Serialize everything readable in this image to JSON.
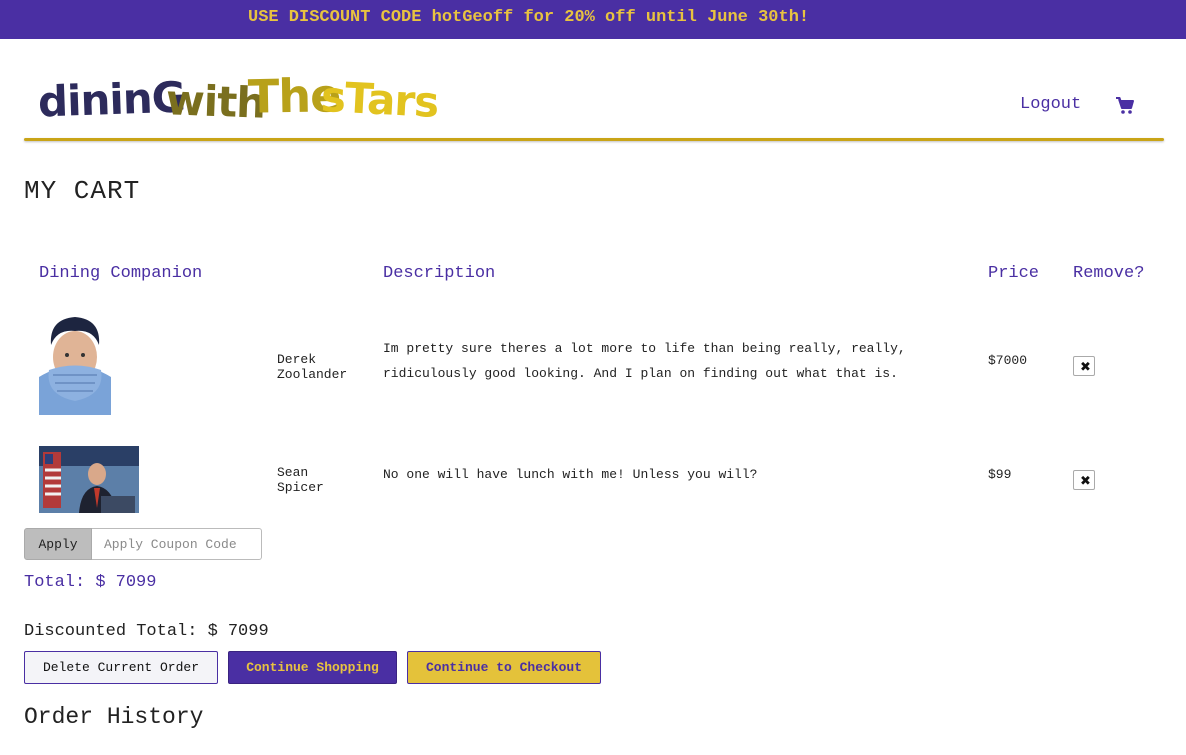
{
  "banner": {
    "text": "USE DISCOUNT CODE hotGeoff for 20% off until June 30th!"
  },
  "header": {
    "logo_words": [
      "dininG",
      "with",
      "The",
      "sTars"
    ],
    "logout_label": "Logout",
    "cart_icon": "shopping-cart-icon"
  },
  "page_title": "MY CART",
  "table": {
    "headers": {
      "companion": "Dining Companion",
      "description": "Description",
      "price": "Price",
      "remove": "Remove?"
    },
    "rows": [
      {
        "name_line1": "Derek",
        "name_line2": "Zoolander",
        "description": "Im pretty sure theres a lot more to life than being really, really, ridiculously good looking. And I plan on finding out what that is.",
        "price": "$7000",
        "remove_icon": "close-icon",
        "remove_label": "✖"
      },
      {
        "name_line1": "Sean",
        "name_line2": "Spicer",
        "description": "No one will have lunch with me! Unless you will?",
        "price": "$99",
        "remove_icon": "close-icon",
        "remove_label": "✖"
      }
    ]
  },
  "coupon": {
    "apply_label": "Apply",
    "placeholder": "Apply Coupon Code",
    "value": ""
  },
  "totals": {
    "total_label": "Total: $",
    "total_value": "7099",
    "discounted_label": "Discounted Total: $",
    "discounted_value": "7099"
  },
  "actions": {
    "delete_label": "Delete Current Order",
    "continue_label": "Continue Shopping",
    "checkout_label": "Continue to Checkout"
  },
  "order_history_title": "Order History",
  "colors": {
    "brand_purple": "#4a2fa3",
    "brand_gold": "#e4c23a"
  }
}
